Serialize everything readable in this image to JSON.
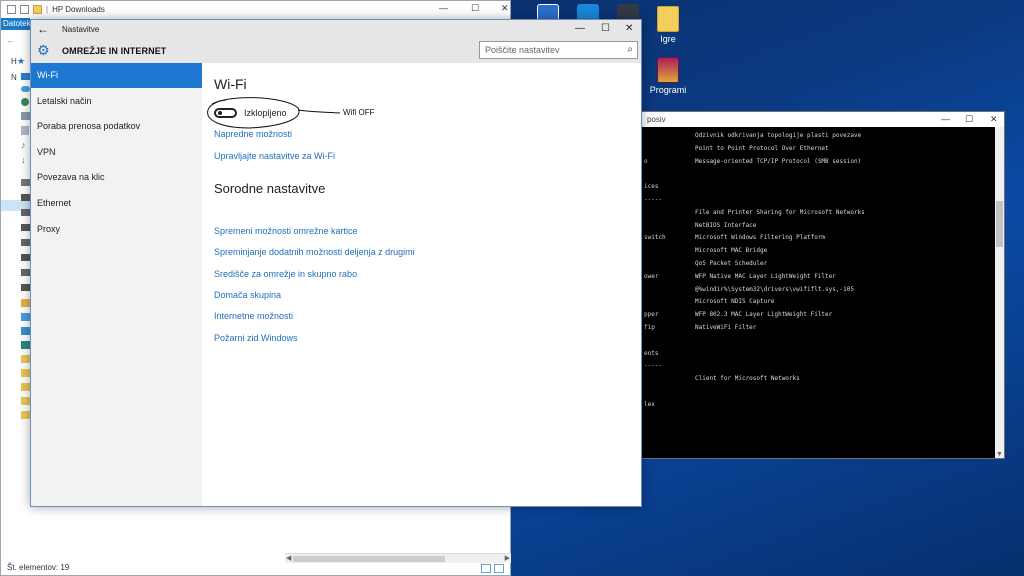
{
  "desktop": {
    "icons": [
      {
        "label": "Igre"
      },
      {
        "label": "Programi"
      }
    ]
  },
  "explorer": {
    "title": "HP Downloads",
    "ribbon_tab": "Datoteka",
    "sidebar_labels": [
      "H",
      "N"
    ],
    "status": "Št. elementov: 19"
  },
  "console": {
    "title": "posiv",
    "lines": [
      {
        "l": "",
        "r": "Odzivnik odkrivanja topologije plasti povezave"
      },
      {
        "l": "",
        "r": "Point to Point Protocol Over Ethernet"
      },
      {
        "l": "o",
        "r": "Message-oriented TCP/IP Protocol (SMB session)"
      },
      {
        "l": "",
        "r": ""
      },
      {
        "l": "ices",
        "r": ""
      },
      {
        "l": "-----",
        "r": ""
      },
      {
        "l": "",
        "r": "File and Printer Sharing for Microsoft Networks"
      },
      {
        "l": "",
        "r": "NetBIOS Interface"
      },
      {
        "l": "switch",
        "r": "Microsoft Windows Filtering Platform"
      },
      {
        "l": "",
        "r": "Microsoft MAC Bridge"
      },
      {
        "l": "",
        "r": "QoS Packet Scheduler"
      },
      {
        "l": "ower",
        "r": "WFP Native MAC Layer LightWeight Filter"
      },
      {
        "l": "",
        "r": "@%windir%\\System32\\drivers\\vwififlt.sys,-105"
      },
      {
        "l": "",
        "r": "Microsoft NDIS Capture"
      },
      {
        "l": "pper",
        "r": "WFP 802.3 MAC Layer LightWeight Filter"
      },
      {
        "l": "fip",
        "r": "NativeWiFi Filter"
      },
      {
        "l": "",
        "r": ""
      },
      {
        "l": "ents",
        "r": ""
      },
      {
        "l": "-----",
        "r": ""
      },
      {
        "l": "",
        "r": "Client for Microsoft Networks"
      },
      {
        "l": "",
        "r": ""
      },
      {
        "l": "lex",
        "r": ""
      }
    ]
  },
  "settings": {
    "window_title": "Nastavitve",
    "header": "OMREŽJE IN INTERNET",
    "search_placeholder": "Poiščite nastavitev",
    "nav": [
      {
        "label": "Wi-Fi",
        "active": true
      },
      {
        "label": "Letalski način",
        "active": false
      },
      {
        "label": "Poraba prenosa podatkov",
        "active": false
      },
      {
        "label": "VPN",
        "active": false
      },
      {
        "label": "Povezava na klic",
        "active": false
      },
      {
        "label": "Ethernet",
        "active": false
      },
      {
        "label": "Proxy",
        "active": false
      }
    ],
    "content": {
      "heading": "Wi-Fi",
      "toggle_state_label": "Izklopljeno",
      "toggle_on": false,
      "links_top": [
        "Napredne možnosti",
        "Upravljajte nastavitve za Wi-Fi"
      ],
      "related_heading": "Sorodne nastavitve",
      "related_links": [
        "Spremeni možnosti omrežne kartice",
        "Spreminjanje dodatnih možnosti deljenja z drugimi",
        "Središče za omrežje in skupno rabo",
        "Domača skupina",
        "Internetne možnosti",
        "Požarni zid Windows"
      ]
    },
    "annotation": "Wifi OFF"
  },
  "colors": {
    "accent": "#1e78d2",
    "link": "#1e6fc0"
  }
}
